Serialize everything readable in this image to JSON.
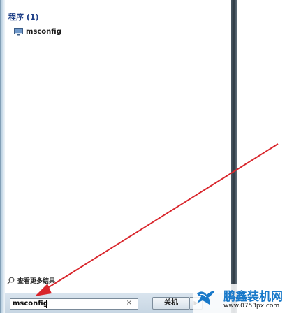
{
  "start_menu": {
    "programs_header": "程序 (1)",
    "results": [
      {
        "label": "msconfig",
        "icon": "msconfig-icon"
      }
    ],
    "see_more_label": "查看更多结果"
  },
  "search": {
    "value": "msconfig",
    "clear_glyph": "×"
  },
  "shutdown": {
    "label": "关机",
    "arrow_glyph": "▶"
  },
  "annotation": {
    "arrow_color": "#d9262c"
  },
  "watermark": {
    "title": "鹏鑫装机网",
    "url": "www.0753px.com",
    "brand_color": "#1979c9"
  }
}
